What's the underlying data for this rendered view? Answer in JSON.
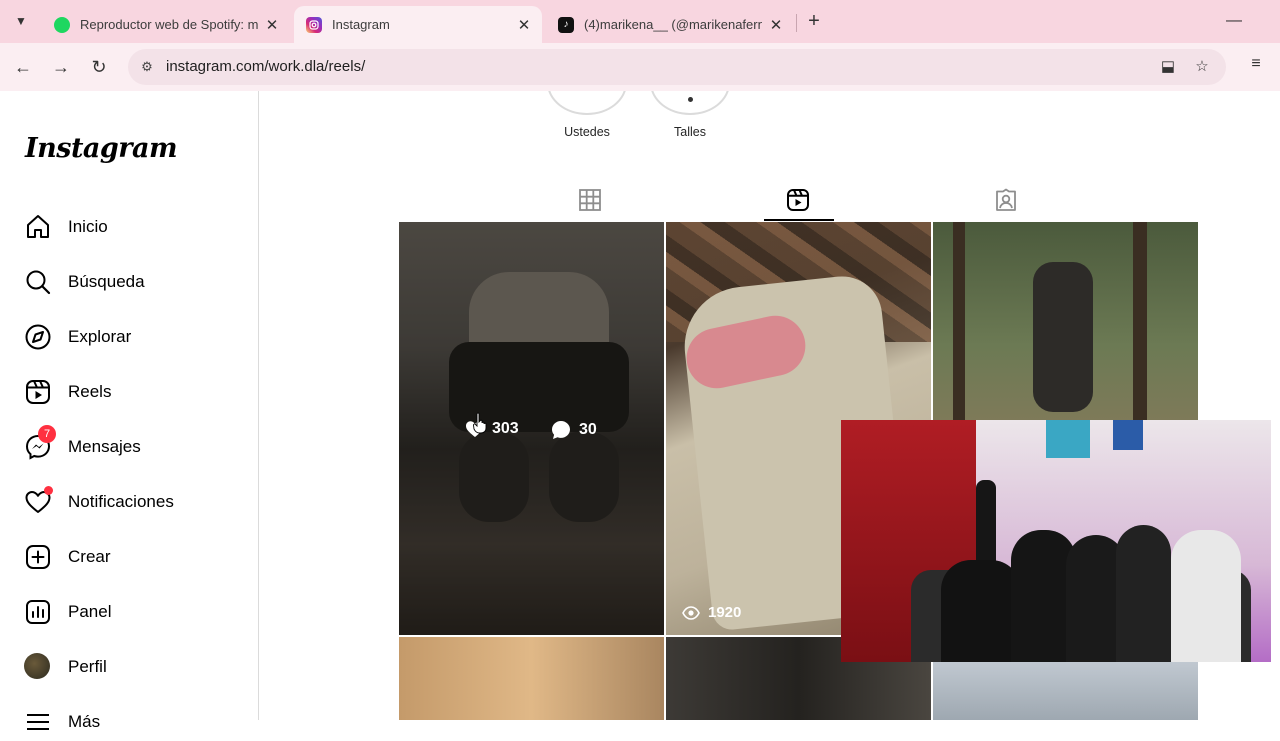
{
  "browser": {
    "tabs": [
      {
        "title": "Reproductor web de Spotify: m",
        "favicon": "spotify-icon"
      },
      {
        "title": "Instagram",
        "favicon": "instagram-icon"
      },
      {
        "title": "(4)marikena__ (@marikenaferna",
        "favicon": "tiktok-icon"
      }
    ],
    "url": "instagram.com/work.dla/reels/"
  },
  "instagram": {
    "logo": "Instagram",
    "nav": [
      {
        "label": "Inicio",
        "icon": "home-icon"
      },
      {
        "label": "Búsqueda",
        "icon": "search-icon"
      },
      {
        "label": "Explorar",
        "icon": "compass-icon"
      },
      {
        "label": "Reels",
        "icon": "reels-icon"
      },
      {
        "label": "Mensajes",
        "icon": "messenger-icon",
        "badge": "7"
      },
      {
        "label": "Notificaciones",
        "icon": "heart-icon"
      },
      {
        "label": "Crear",
        "icon": "plus-square-icon"
      },
      {
        "label": "Panel",
        "icon": "chart-icon"
      },
      {
        "label": "Perfil",
        "icon": "avatar-icon"
      },
      {
        "label": "Más",
        "icon": "menu-icon"
      }
    ],
    "highlights": [
      {
        "label": "Ustedes"
      },
      {
        "label": "Talles"
      }
    ],
    "reels": [
      {
        "likes": "303",
        "comments": "30",
        "hover": true
      },
      {
        "views": "1920"
      },
      {}
    ],
    "accent": "#ff3040"
  }
}
